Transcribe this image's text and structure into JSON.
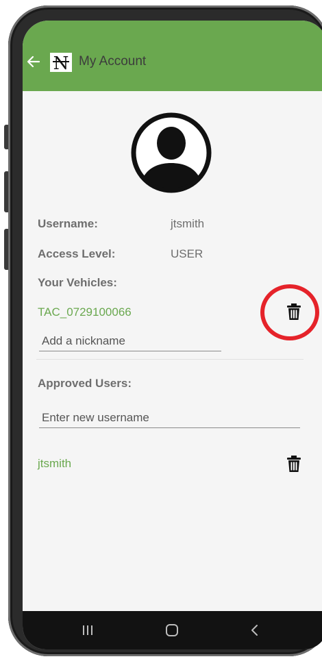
{
  "appbar": {
    "title": "My Account",
    "logo_letter": "N"
  },
  "account": {
    "username_label": "Username:",
    "username_value": "jtsmith",
    "access_label": "Access Level:",
    "access_value": "USER",
    "vehicles_label": "Your Vehicles:"
  },
  "vehicle": {
    "id": "TAC_0729100066",
    "nickname_placeholder": "Add a nickname"
  },
  "approved": {
    "label": "Approved Users:",
    "new_user_placeholder": "Enter new username",
    "users": [
      "jtsmith"
    ]
  },
  "icons": {
    "back": "arrow-left-icon",
    "logo": "app-logo-icon",
    "avatar": "user-avatar-icon",
    "trash": "trash-icon",
    "nav_recents": "recents-icon",
    "nav_home": "home-icon",
    "nav_back": "chevron-left-icon"
  },
  "colors": {
    "accent": "#6aa84f",
    "highlight": "#e5232a",
    "navbar": "#121212"
  }
}
